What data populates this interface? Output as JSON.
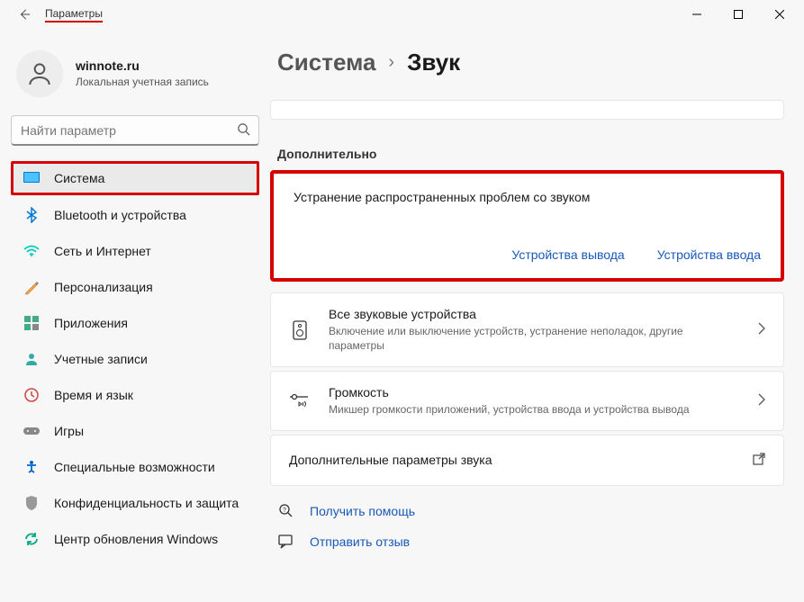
{
  "window": {
    "title": "Параметры"
  },
  "user": {
    "name": "winnote.ru",
    "subtitle": "Локальная учетная запись"
  },
  "search": {
    "placeholder": "Найти параметр"
  },
  "nav": {
    "items": [
      {
        "label": "Система",
        "icon": "system"
      },
      {
        "label": "Bluetooth и устройства",
        "icon": "bluetooth"
      },
      {
        "label": "Сеть и Интернет",
        "icon": "network"
      },
      {
        "label": "Персонализация",
        "icon": "personalization"
      },
      {
        "label": "Приложения",
        "icon": "apps"
      },
      {
        "label": "Учетные записи",
        "icon": "accounts"
      },
      {
        "label": "Время и язык",
        "icon": "time"
      },
      {
        "label": "Игры",
        "icon": "gaming"
      },
      {
        "label": "Специальные возможности",
        "icon": "accessibility"
      },
      {
        "label": "Конфиденциальность и защита",
        "icon": "privacy"
      },
      {
        "label": "Центр обновления Windows",
        "icon": "update"
      }
    ]
  },
  "breadcrumb": {
    "parent": "Система",
    "current": "Звук"
  },
  "section": {
    "additional": "Дополнительно"
  },
  "troubleshoot": {
    "title": "Устранение распространенных проблем со звуком",
    "output": "Устройства вывода",
    "input": "Устройства ввода"
  },
  "cards": {
    "all_devices": {
      "title": "Все звуковые устройства",
      "subtitle": "Включение или выключение устройств, устранение неполадок, другие параметры"
    },
    "volume": {
      "title": "Громкость",
      "subtitle": "Микшер громкости приложений, устройства ввода и устройства вывода"
    },
    "more": {
      "title": "Дополнительные параметры звука"
    }
  },
  "help": {
    "get_help": "Получить помощь",
    "feedback": "Отправить отзыв"
  }
}
